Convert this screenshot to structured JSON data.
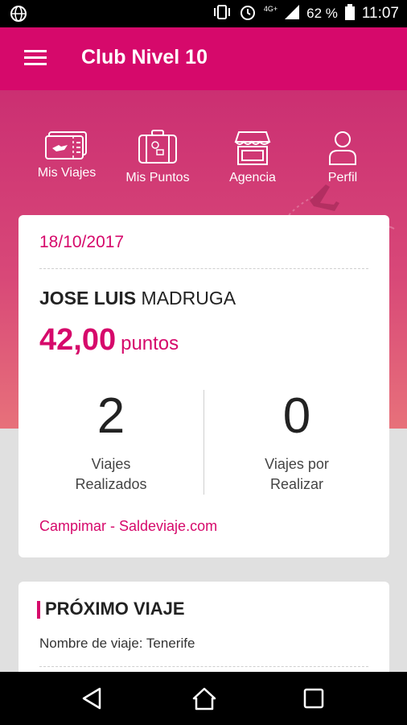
{
  "status_bar": {
    "network": "4G+",
    "battery": "62 %",
    "time": "11:07"
  },
  "app_bar": {
    "title": "Club Nivel 10"
  },
  "nav": [
    {
      "label": "Mis Viajes",
      "icon": "ticket-icon"
    },
    {
      "label": "Mis Puntos",
      "icon": "suitcase-icon"
    },
    {
      "label": "Agencia",
      "icon": "store-icon"
    },
    {
      "label": "Perfil",
      "icon": "person-icon"
    }
  ],
  "card": {
    "date": "18/10/2017",
    "first_name": "JOSE LUIS",
    "last_name": "MADRUGA",
    "points_value": "42,00",
    "points_unit": "puntos",
    "stats": [
      {
        "value": "2",
        "label_line1": "Viajes",
        "label_line2": "Realizados"
      },
      {
        "value": "0",
        "label_line1": "Viajes por",
        "label_line2": "Realizar"
      }
    ],
    "link": "Campimar - Saldeviaje.com"
  },
  "next_trip": {
    "title": "PRÓXIMO VIAJE",
    "text": "Nombre de viaje: Tenerife"
  },
  "colors": {
    "brand": "#d6096b",
    "hero_top": "#cb2f72",
    "hero_bottom": "#e7717a"
  }
}
